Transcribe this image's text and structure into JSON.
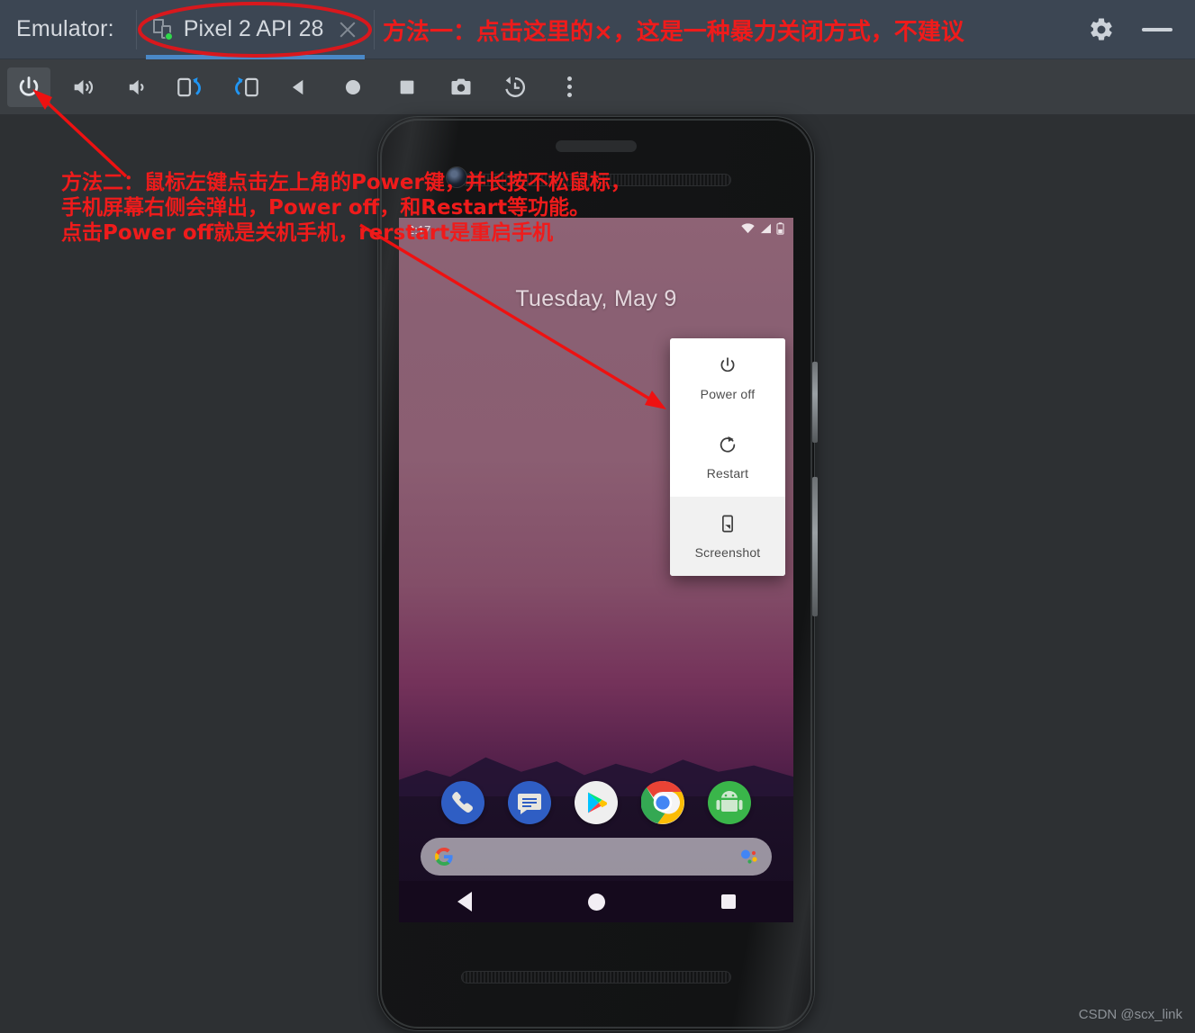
{
  "window": {
    "app_label": "Emulator:",
    "tab": {
      "label": "Pixel 2 API 28",
      "close_label": "×",
      "device_icon": "device-running-icon",
      "active": true
    },
    "controls": {
      "settings_icon": "gear-icon",
      "minimize_icon": "minimize-icon"
    }
  },
  "toolbar": {
    "buttons": [
      {
        "name": "power-button",
        "icon": "power-icon",
        "pressed": true
      },
      {
        "name": "volume-up-button",
        "icon": "volume-up-icon",
        "pressed": false
      },
      {
        "name": "volume-down-button",
        "icon": "volume-down-icon",
        "pressed": false
      },
      {
        "name": "rotate-left-button",
        "icon": "rotate-left-icon",
        "pressed": false
      },
      {
        "name": "rotate-right-button",
        "icon": "rotate-right-icon",
        "pressed": false
      },
      {
        "name": "back-button",
        "icon": "triangle-back-icon",
        "pressed": false
      },
      {
        "name": "home-button",
        "icon": "circle-home-icon",
        "pressed": false
      },
      {
        "name": "overview-button",
        "icon": "square-overview-icon",
        "pressed": false
      },
      {
        "name": "screenshot-button",
        "icon": "camera-icon",
        "pressed": false
      },
      {
        "name": "history-button",
        "icon": "clock-rewind-icon",
        "pressed": false
      },
      {
        "name": "more-button",
        "icon": "three-dots-icon",
        "pressed": false
      }
    ]
  },
  "device": {
    "status_bar": {
      "time": "2:17",
      "icons": [
        "wifi-icon",
        "signal-icon",
        "battery-icon"
      ]
    },
    "lockscreen_date": "Tuesday, May 9",
    "power_menu": [
      {
        "label": "Power off",
        "icon": "power-icon",
        "shaded": false
      },
      {
        "label": "Restart",
        "icon": "restart-icon",
        "shaded": false
      },
      {
        "label": "Screenshot",
        "icon": "screenshot-icon",
        "shaded": true
      }
    ],
    "dock_apps": [
      {
        "name": "phone-app",
        "label": "Phone"
      },
      {
        "name": "messages-app",
        "label": "Messages"
      },
      {
        "name": "play-store-app",
        "label": "Play Store"
      },
      {
        "name": "chrome-app",
        "label": "Chrome"
      },
      {
        "name": "api-demos-app",
        "label": "API Demos"
      }
    ],
    "search_bar": {
      "placeholder": "",
      "value": "",
      "logo": "google-g-icon",
      "assistant": "google-assistant-icon"
    },
    "nav_bar": [
      "back-icon",
      "home-icon",
      "recents-icon"
    ]
  },
  "annotations": {
    "top_note": "方法一：点击这里的×，这是一种暴力关闭方式，不建议",
    "body_line1": "方法二：鼠标左键点击左上角的Power键，并长按不松鼠标，",
    "body_line2": "手机屏幕右侧会弹出，Power off，和Restart等功能。",
    "body_line3": "点击Power off就是关机手机，rerstart是重启手机",
    "accent_color": "#ef1b1b"
  },
  "watermark": "CSDN @scx_link"
}
